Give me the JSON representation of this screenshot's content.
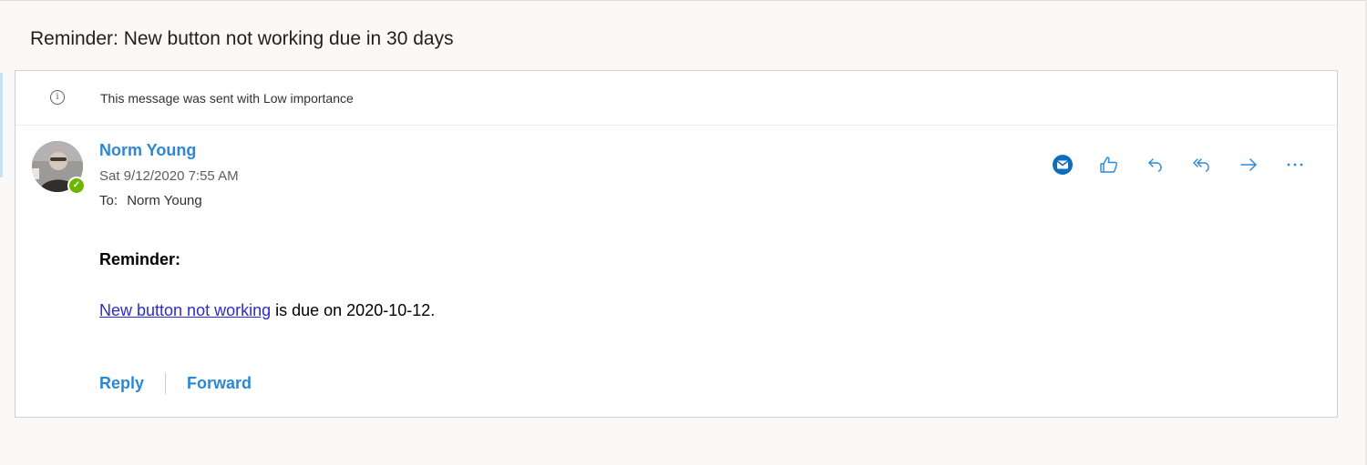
{
  "subject": "Reminder: New button not working due in 30 days",
  "info_bar": {
    "icon": "info-icon",
    "text": "This message was sent with Low importance"
  },
  "message": {
    "sender_name": "Norm Young",
    "date": "Sat 9/12/2020 7:55 AM",
    "to_label": "To:",
    "to_name": "Norm Young",
    "presence_status": "available",
    "presence_color": "#6bb700"
  },
  "actions": [
    {
      "name": "outlook-mail-icon"
    },
    {
      "name": "like-icon"
    },
    {
      "name": "reply-icon"
    },
    {
      "name": "reply-all-icon"
    },
    {
      "name": "forward-icon"
    },
    {
      "name": "more-icon"
    }
  ],
  "body": {
    "heading": "Reminder:",
    "link_text": "New button not working",
    "line_suffix": " is due on 2020-10-12."
  },
  "footer": {
    "reply_label": "Reply",
    "forward_label": "Forward"
  },
  "colors": {
    "accent": "#2b88d8",
    "link": "#2b2bd6"
  }
}
